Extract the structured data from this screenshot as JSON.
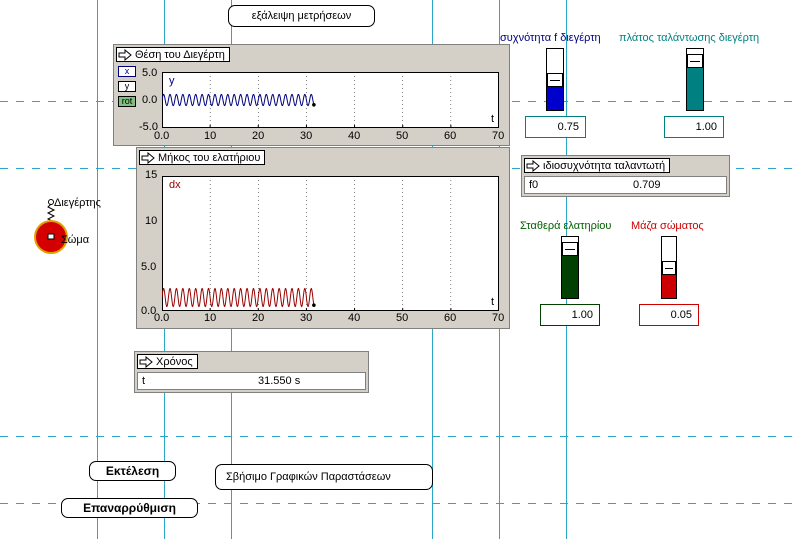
{
  "top_button": "εξάλειψη μετρήσεων",
  "panels": {
    "position": {
      "title": "Θέση του Διεγέρτη",
      "legend": [
        "x",
        "y",
        "rot"
      ],
      "var_label": "y",
      "axis_var": "t",
      "y_ticks": [
        "5.0",
        "0.0",
        "-5.0"
      ],
      "x_ticks": [
        "0.0",
        "10",
        "20",
        "30",
        "40",
        "50",
        "60",
        "70"
      ]
    },
    "spring": {
      "title": "Μήκος του ελατήριου",
      "var_label": "dx",
      "axis_var": "t",
      "y_ticks": [
        "15",
        "10",
        "5.0",
        "0.0"
      ],
      "x_ticks": [
        "0.0",
        "10",
        "20",
        "30",
        "40",
        "50",
        "60",
        "70"
      ]
    },
    "time": {
      "title": "Χρόνος",
      "var": "t",
      "value": "31.550 s"
    },
    "natural_freq": {
      "title": "ιδιοσυχνότητα ταλαντωτή",
      "var": "f0",
      "value": "0.709"
    }
  },
  "sliders": {
    "frequency": {
      "label": "συχνότητα f διεγέρτη",
      "value": "0.75",
      "color": "#0000cc",
      "level": 0.5
    },
    "amplitude": {
      "label": "πλάτος ταλάντωσης διεγέρτη",
      "value": "1.00",
      "color": "#008080",
      "level": 0.8
    },
    "spring_constant": {
      "label": "Σταθερά ελατηρίου",
      "value": "1.00",
      "color": "#004000",
      "level": 0.8
    },
    "mass": {
      "label": "Μάζα σώματος",
      "value": "0.05",
      "color": "#cc0000",
      "level": 0.5
    }
  },
  "scene": {
    "driver_label": "Διεγέρτης",
    "body_label": "Σώμα"
  },
  "buttons": {
    "run": "Εκτέλεση",
    "reset": "Επαναρρύθμιση",
    "clear_graphs": "Σβήσιμο Γραφικών Παραστάσεων"
  },
  "chart_data": [
    {
      "type": "line",
      "title": "Θέση του Διεγέρτη",
      "xlabel": "t",
      "ylabel": "y",
      "xlim": [
        0,
        70
      ],
      "ylim": [
        -5,
        5
      ],
      "series": [
        {
          "name": "y",
          "color": "#000080",
          "amplitude": 1.0,
          "frequency": 0.75,
          "t_end": 31.55
        }
      ]
    },
    {
      "type": "line",
      "title": "Μήκος του ελατήριου",
      "xlabel": "t",
      "ylabel": "dx",
      "xlim": [
        0,
        70
      ],
      "ylim": [
        0,
        15
      ],
      "series": [
        {
          "name": "dx",
          "color": "#990000",
          "min": 0.5,
          "max": 2.5,
          "frequency": 0.75,
          "t_end": 31.55
        }
      ]
    }
  ]
}
